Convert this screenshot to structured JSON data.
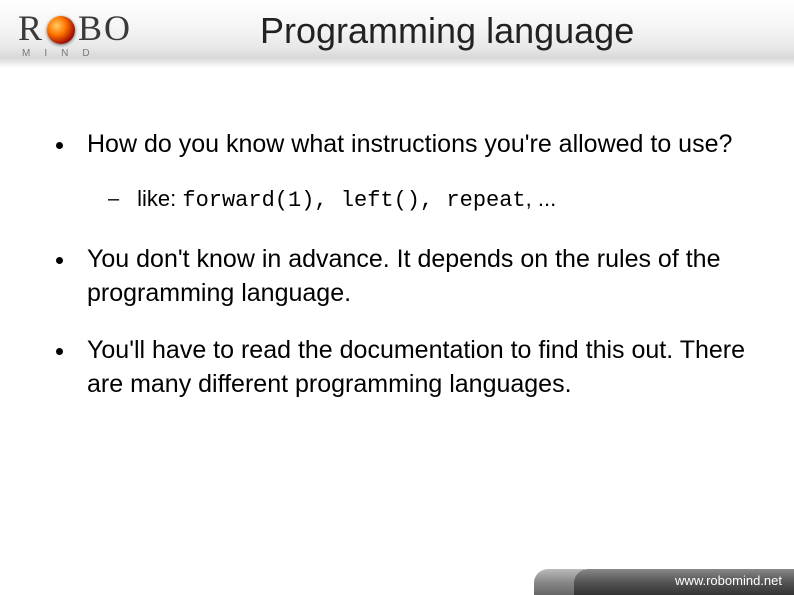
{
  "logo": {
    "main_left": "R",
    "main_right": "BO",
    "sub": "MIND"
  },
  "title": "Programming language",
  "bullets": [
    {
      "text": "How do you know what instructions you're allowed to use?",
      "sub": {
        "prefix": "like: ",
        "code": "forward(1), left(), repeat",
        "suffix": ", ..."
      }
    },
    {
      "text": "You don't know in advance. It depends on the rules of the programming language."
    },
    {
      "text": "You'll have to read the documentation to find this out. There are many different programming languages."
    }
  ],
  "footer": {
    "url": "www.robomind.net"
  }
}
